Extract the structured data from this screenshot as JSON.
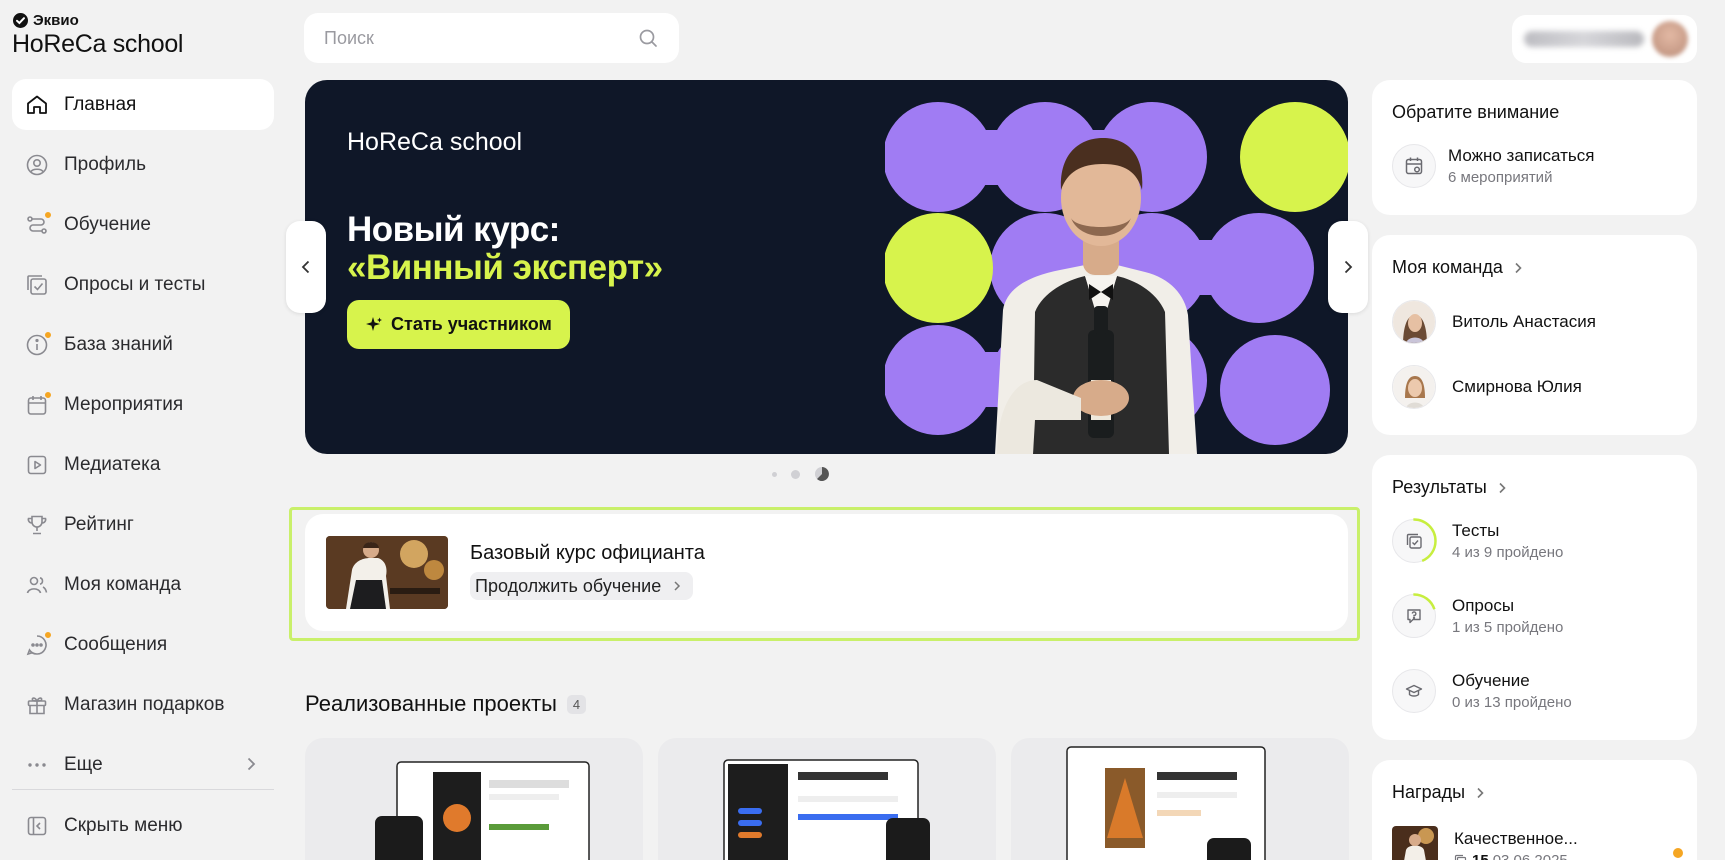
{
  "brand": {
    "company": "Эквио",
    "product": "HoReCa school"
  },
  "search": {
    "placeholder": "Поиск"
  },
  "nav": {
    "items": [
      {
        "label": "Главная"
      },
      {
        "label": "Профиль"
      },
      {
        "label": "Обучение"
      },
      {
        "label": "Опросы и тесты"
      },
      {
        "label": "База знаний"
      },
      {
        "label": "Мероприятия"
      },
      {
        "label": "Медиатека"
      },
      {
        "label": "Рейтинг"
      },
      {
        "label": "Моя команда"
      },
      {
        "label": "Сообщения"
      },
      {
        "label": "Магазин подарков"
      },
      {
        "label": "Еще"
      }
    ],
    "hide_menu": "Скрыть меню"
  },
  "banner": {
    "brand": "HoReCa school",
    "title_line1": "Новый курс:",
    "title_line2": "«Винный эксперт»",
    "cta": "Стать участником",
    "accent": "#d7f34c",
    "bg": "#0f1728",
    "shapes_color": "#a07cf3"
  },
  "course": {
    "title": "Базовый курс официанта",
    "cta": "Продолжить обучение"
  },
  "projects": {
    "title": "Реализованные проекты",
    "count": "4"
  },
  "attention": {
    "title": "Обратите внимание",
    "main": "Можно записаться",
    "sub": "6 мероприятий"
  },
  "team": {
    "title": "Моя команда",
    "members": [
      {
        "name": "Витоль Анастасия"
      },
      {
        "name": "Смирнова Юлия"
      }
    ]
  },
  "results": {
    "title": "Результаты",
    "items": [
      {
        "main": "Тесты",
        "sub": "4 из 9 пройдено",
        "progress": 0.44
      },
      {
        "main": "Опросы",
        "sub": "1 из 5 пройдено",
        "progress": 0.2
      },
      {
        "main": "Обучение",
        "sub": "0 из 13 пройдено",
        "progress": 0
      }
    ]
  },
  "awards": {
    "title": "Награды",
    "item_title": "Качественное...",
    "item_count": "15",
    "item_date": "03.06.2025"
  }
}
